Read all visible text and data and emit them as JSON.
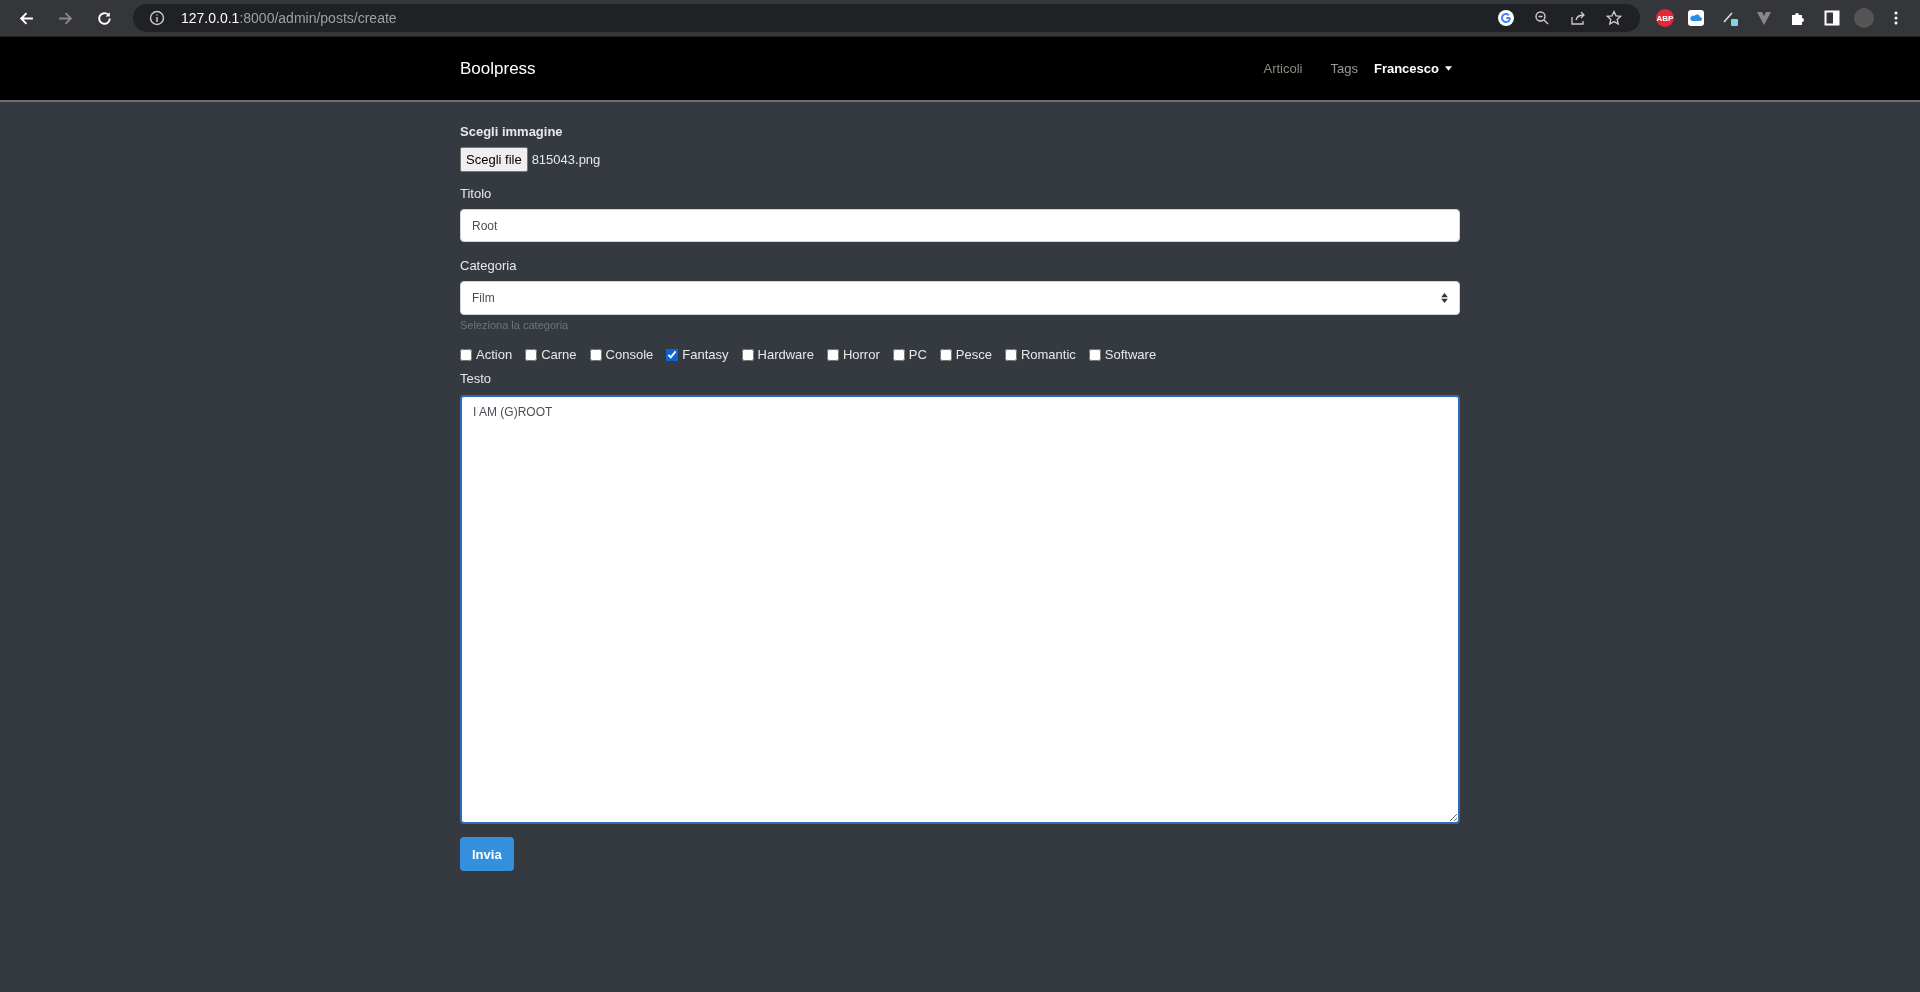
{
  "browser": {
    "url_host": "127.0.0.1",
    "url_path": ":8000/admin/posts/create",
    "abp_label": "ABP"
  },
  "navbar": {
    "brand": "Boolpress",
    "links": [
      {
        "label": "Articoli"
      },
      {
        "label": "Tags"
      }
    ],
    "user": "Francesco"
  },
  "form": {
    "image_label": "Scegli immagine",
    "file_button": "Scegli file",
    "file_name": "815043.png",
    "title_label": "Titolo",
    "title_value": "Root",
    "category_label": "Categoria",
    "category_value": "Film",
    "category_help": "Seleziona la categoria",
    "tags": [
      {
        "label": "Action",
        "checked": false
      },
      {
        "label": "Carne",
        "checked": false
      },
      {
        "label": "Console",
        "checked": false
      },
      {
        "label": "Fantasy",
        "checked": true
      },
      {
        "label": "Hardware",
        "checked": false
      },
      {
        "label": "Horror",
        "checked": false
      },
      {
        "label": "PC",
        "checked": false
      },
      {
        "label": "Pesce",
        "checked": false
      },
      {
        "label": "Romantic",
        "checked": false
      },
      {
        "label": "Software",
        "checked": false
      }
    ],
    "text_label": "Testo",
    "text_value": "I AM (G)ROOT",
    "submit": "Invia"
  }
}
